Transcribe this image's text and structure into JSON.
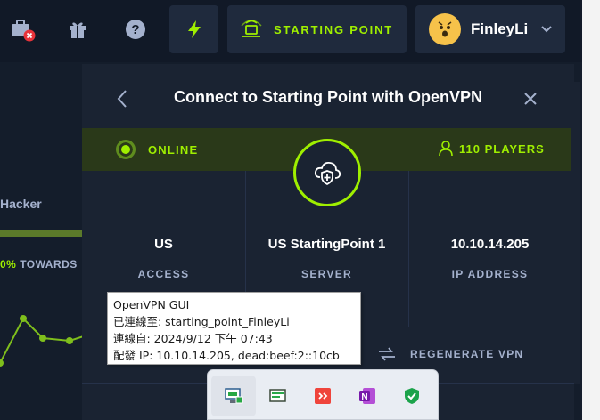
{
  "header": {
    "starting_point_label": "STARTING POINT",
    "user_name": "FinleyLi",
    "icons": [
      "toolbox-alert-icon",
      "gift-icon",
      "help-icon",
      "bolt-icon",
      "vpn-desk-icon",
      "chevron-down-icon"
    ]
  },
  "background": {
    "rank_label": "Hacker",
    "towards_pct": "0%",
    "towards_label": "TOWARDS"
  },
  "panel": {
    "title": "Connect to Starting Point with OpenVPN",
    "status": "ONLINE",
    "players": "110 PLAYERS",
    "access_value": "US",
    "access_label": "ACCESS",
    "server_value": "US StartingPoint 1",
    "server_label": "SERVER",
    "ip_value": "10.10.14.205",
    "ip_label": "IP ADDRESS",
    "regenerate_label": "REGENERATE VPN"
  },
  "tooltip": {
    "title": "OpenVPN GUI",
    "line1": "已連線至: starting_point_FinleyLi",
    "line2": "連線自: 2024/9/12 下午 07:43",
    "line3": "配發 IP: 10.10.14.205, dead:beef:2::10cb"
  },
  "tray": {
    "items": [
      "openvpn-connected-icon",
      "network-monitor-icon",
      "anydesk-icon",
      "onenote-icon",
      "security-shield-icon"
    ]
  },
  "colors": {
    "accent": "#9fef00",
    "background": "#141d2b",
    "panel": "#1a2332",
    "muted": "#a4b1cd"
  }
}
